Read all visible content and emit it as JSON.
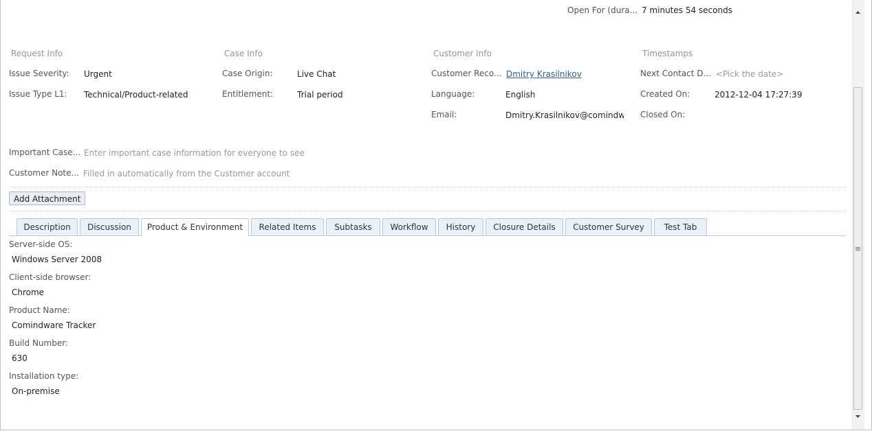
{
  "summary": {
    "open_for_label": "Open For (dura...",
    "open_for_value": "7 minutes 54 seconds"
  },
  "sections": {
    "request_info": {
      "title": "Request Info",
      "fields": [
        {
          "label": "Issue Severity:",
          "value": "Urgent"
        },
        {
          "label": "Issue Type L1:",
          "value": "Technical/Product-related"
        }
      ]
    },
    "case_info": {
      "title": "Case Info",
      "fields": [
        {
          "label": "Case Origin:",
          "value": "Live Chat"
        },
        {
          "label": "Entitlement:",
          "value": "Trial period"
        }
      ]
    },
    "customer_info": {
      "title": "Customer Info",
      "fields": [
        {
          "label": "Customer Reco...",
          "value": "Dmitry Krasilnikov"
        },
        {
          "label": "Language:",
          "value": "English"
        },
        {
          "label": "Email:",
          "value": "Dmitry.Krasilnikov@comindwa"
        }
      ]
    },
    "timestamps": {
      "title": "Timestamps",
      "fields": [
        {
          "label": "Next Contact D...",
          "value": "<Pick the date>"
        },
        {
          "label": "Created On:",
          "value": "2012-12-04 17:27:39"
        },
        {
          "label": "Closed On:",
          "value": ""
        }
      ]
    }
  },
  "notes": {
    "important_label": "Important Case...",
    "important_placeholder": "Enter important case information for everyone to see",
    "customer_label": "Customer Note...",
    "customer_placeholder": "Filled in automatically from the Customer account"
  },
  "toolbar": {
    "add_attachment": "Add Attachment"
  },
  "tabs": [
    {
      "label": "Description",
      "active": false
    },
    {
      "label": "Discussion",
      "active": false
    },
    {
      "label": "Product & Environment",
      "active": true
    },
    {
      "label": "Related Items",
      "active": false
    },
    {
      "label": "Subtasks",
      "active": false
    },
    {
      "label": "Workflow",
      "active": false
    },
    {
      "label": "History",
      "active": false
    },
    {
      "label": "Closure Details",
      "active": false
    },
    {
      "label": "Customer Survey",
      "active": false
    },
    {
      "label": "Test Tab",
      "active": false
    }
  ],
  "product_env": [
    {
      "label": "Server-side OS:",
      "value": "Windows Server 2008"
    },
    {
      "label": "Client-side browser:",
      "value": "Chrome"
    },
    {
      "label": "Product Name:",
      "value": "Comindware Tracker"
    },
    {
      "label": "Build Number:",
      "value": "630"
    },
    {
      "label": "Installation type:",
      "value": "On-premise"
    }
  ]
}
